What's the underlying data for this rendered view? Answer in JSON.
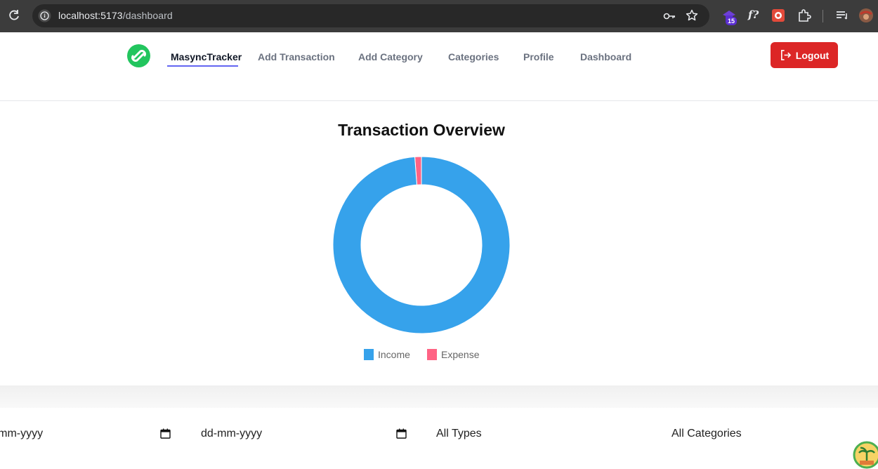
{
  "browser": {
    "url_host": "localhost:5173",
    "url_path": "/dashboard",
    "extension_badge": "15"
  },
  "navbar": {
    "items": [
      {
        "label": "MasyncTracker"
      },
      {
        "label": "Add Transaction"
      },
      {
        "label": "Add Category"
      },
      {
        "label": "Categories"
      },
      {
        "label": "Profile"
      },
      {
        "label": "Dashboard"
      }
    ],
    "logout_label": "Logout"
  },
  "chart_data": {
    "type": "pie",
    "title": "Transaction Overview",
    "categories": [
      "Income",
      "Expense"
    ],
    "values": [
      98.8,
      1.2
    ],
    "colors": [
      "#36a2eb",
      "#ff6384"
    ],
    "legend_position": "bottom",
    "donut": true
  },
  "filters": {
    "start_date_placeholder": "dd-mm-yyyy",
    "end_date_placeholder": "dd-mm-yyyy",
    "type_selected": "All Types",
    "category_selected": "All Categories"
  },
  "colors": {
    "accent": "#6366f1",
    "logout": "#dc2626",
    "logo": "#22c55e"
  }
}
